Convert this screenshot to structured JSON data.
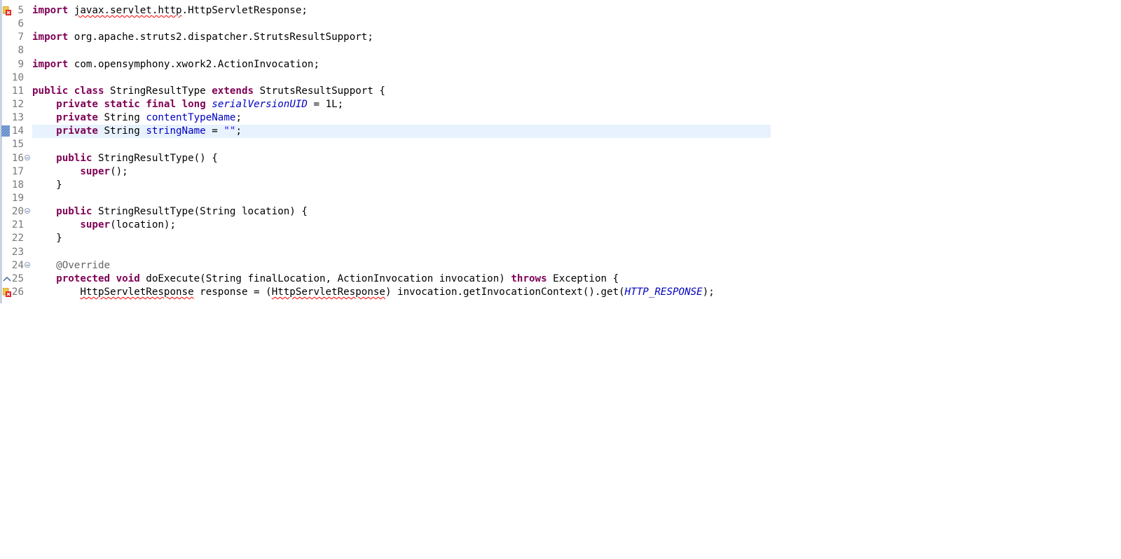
{
  "editor": {
    "lines": [
      {
        "num": "5",
        "marker": "error",
        "tokens": [
          {
            "t": "import",
            "c": "kw"
          },
          {
            "t": " "
          },
          {
            "t": "javax.servlet.http",
            "c": "err"
          },
          {
            "t": ".HttpServletResponse;"
          }
        ]
      },
      {
        "num": "6",
        "tokens": []
      },
      {
        "num": "7",
        "tokens": [
          {
            "t": "import",
            "c": "kw"
          },
          {
            "t": " org.apache.struts2.dispatcher.StrutsResultSupport;"
          }
        ]
      },
      {
        "num": "8",
        "tokens": []
      },
      {
        "num": "9",
        "tokens": [
          {
            "t": "import",
            "c": "kw"
          },
          {
            "t": " com.opensymphony.xwork2.ActionInvocation;"
          }
        ]
      },
      {
        "num": "10",
        "tokens": []
      },
      {
        "num": "11",
        "tokens": [
          {
            "t": "public",
            "c": "kw"
          },
          {
            "t": " "
          },
          {
            "t": "class",
            "c": "kw"
          },
          {
            "t": " StringResultType "
          },
          {
            "t": "extends",
            "c": "kw"
          },
          {
            "t": " StrutsResultSupport {"
          }
        ]
      },
      {
        "num": "12",
        "tokens": [
          {
            "t": "    "
          },
          {
            "t": "private",
            "c": "kw"
          },
          {
            "t": " "
          },
          {
            "t": "static",
            "c": "kw"
          },
          {
            "t": " "
          },
          {
            "t": "final",
            "c": "kw"
          },
          {
            "t": " "
          },
          {
            "t": "long",
            "c": "kw"
          },
          {
            "t": " "
          },
          {
            "t": "serialVersionUID",
            "c": "sfld"
          },
          {
            "t": " = 1L;"
          }
        ]
      },
      {
        "num": "13",
        "tokens": [
          {
            "t": "    "
          },
          {
            "t": "private",
            "c": "kw"
          },
          {
            "t": " String "
          },
          {
            "t": "contentTypeName",
            "c": "fld"
          },
          {
            "t": ";"
          }
        ]
      },
      {
        "num": "14",
        "current": true,
        "marker": "selection",
        "tokens": [
          {
            "t": "    "
          },
          {
            "t": "private",
            "c": "kw"
          },
          {
            "t": " String "
          },
          {
            "t": "stringName",
            "c": "fld"
          },
          {
            "t": " = "
          },
          {
            "t": "\"\"",
            "c": "str"
          },
          {
            "t": ";"
          }
        ]
      },
      {
        "num": "15",
        "tokens": []
      },
      {
        "num": "16",
        "fold": true,
        "tokens": [
          {
            "t": "    "
          },
          {
            "t": "public",
            "c": "kw"
          },
          {
            "t": " StringResultType() {"
          }
        ]
      },
      {
        "num": "17",
        "tokens": [
          {
            "t": "        "
          },
          {
            "t": "super",
            "c": "kw"
          },
          {
            "t": "();"
          }
        ]
      },
      {
        "num": "18",
        "tokens": [
          {
            "t": "    }"
          }
        ]
      },
      {
        "num": "19",
        "tokens": []
      },
      {
        "num": "20",
        "fold": true,
        "tokens": [
          {
            "t": "    "
          },
          {
            "t": "public",
            "c": "kw"
          },
          {
            "t": " StringResultType(String location) {"
          }
        ]
      },
      {
        "num": "21",
        "tokens": [
          {
            "t": "        "
          },
          {
            "t": "super",
            "c": "kw"
          },
          {
            "t": "(location);"
          }
        ]
      },
      {
        "num": "22",
        "tokens": [
          {
            "t": "    }"
          }
        ]
      },
      {
        "num": "23",
        "tokens": []
      },
      {
        "num": "24",
        "fold": true,
        "tokens": [
          {
            "t": "    "
          },
          {
            "t": "@Override",
            "c": "ann"
          }
        ]
      },
      {
        "num": "25",
        "marker": "override",
        "tokens": [
          {
            "t": "    "
          },
          {
            "t": "protected",
            "c": "kw"
          },
          {
            "t": " "
          },
          {
            "t": "void",
            "c": "kw"
          },
          {
            "t": " doExecute(String finalLocation, ActionInvocation invocation) "
          },
          {
            "t": "throws",
            "c": "kw"
          },
          {
            "t": " Exception {"
          }
        ]
      },
      {
        "num": "26",
        "marker": "error",
        "tokens": [
          {
            "t": "        "
          },
          {
            "t": "HttpServletResponse",
            "c": "err"
          },
          {
            "t": " response = ("
          },
          {
            "t": "HttpServletResponse",
            "c": "err"
          },
          {
            "t": ") invocation.getInvocationContext().get("
          },
          {
            "t": "HTTP_RESPONSE",
            "c": "sfld"
          },
          {
            "t": ");"
          }
        ]
      }
    ],
    "colors": {
      "keyword": "#7f0055",
      "field": "#0000c0",
      "string": "#2a00ff",
      "annotation": "#646464",
      "line_number": "#787878",
      "current_line": "#e8f2fe",
      "error_underline": "#ff0000"
    }
  }
}
